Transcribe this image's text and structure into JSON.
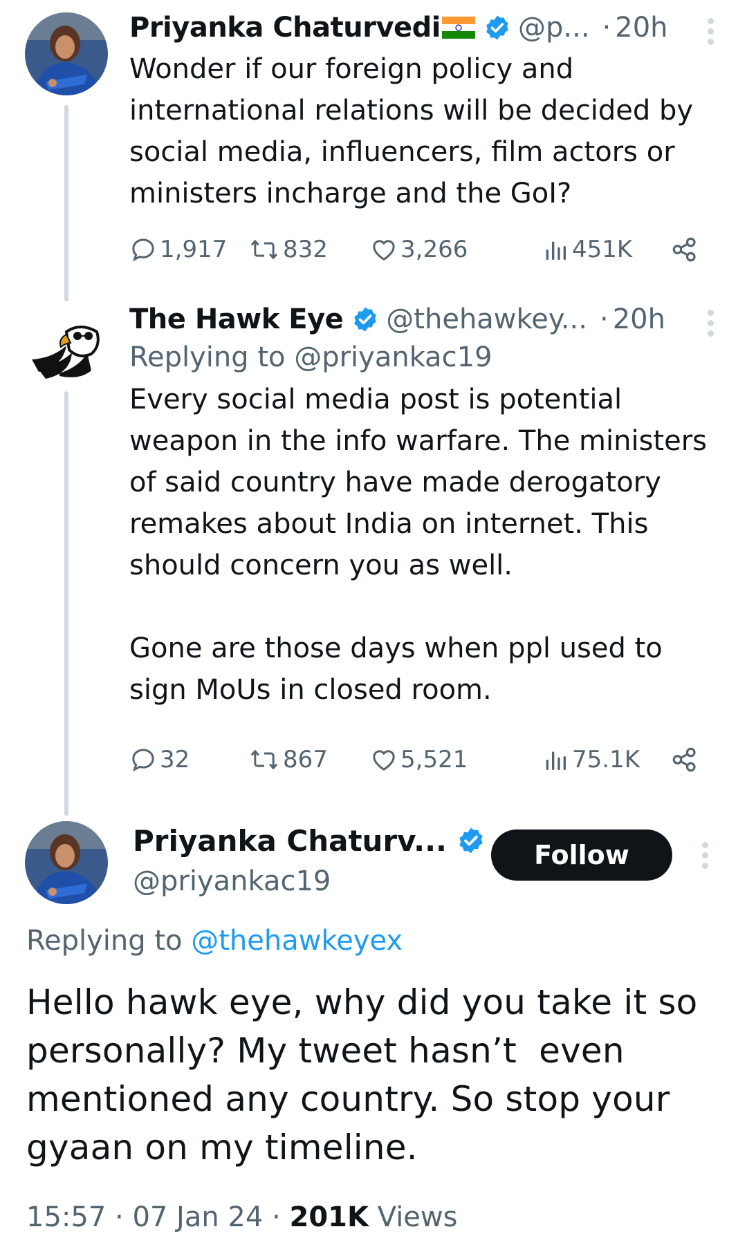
{
  "colors": {
    "accent": "#1d9bf0",
    "text": "#0f1419",
    "muted": "#536471",
    "line": "#cfd9de"
  },
  "tweet1": {
    "name": "Priyanka Chaturvedi",
    "handle": "@p...",
    "dot": "·",
    "time": "20h",
    "text": "Wonder if our foreign policy and international relations will be decided by social media, influencers, film actors or ministers incharge and the GoI?",
    "replies": "1,917",
    "retweets": "832",
    "likes": "3,266",
    "views": "451K"
  },
  "tweet2": {
    "name": "The Hawk Eye",
    "handle": "@thehawkey...",
    "dot": "·",
    "time": "20h",
    "replying": "Replying to @priyankac19",
    "text": "Every social media post is potential weapon in the info warfare. The ministers of said country have made derogatory remakes about India on internet. This should concern you as well.\n\nGone are those days when ppl used to sign MoUs in closed room.",
    "replies": "32",
    "retweets": "867",
    "likes": "5,521",
    "views": "75.1K"
  },
  "main": {
    "name": "Priyanka Chaturv...",
    "handle": "@priyankac19",
    "follow_label": "Follow",
    "replying_prefix": "Replying to",
    "replying_handle": "@thehawkeyex",
    "text": "Hello hawk eye, why did you take it so personally? My tweet hasn’t  even mentioned any country. So stop your gyaan on my timeline.",
    "time": "15:57",
    "sep": "·",
    "date": "07 Jan 24",
    "views_count": "201K",
    "views_label": "Views"
  }
}
